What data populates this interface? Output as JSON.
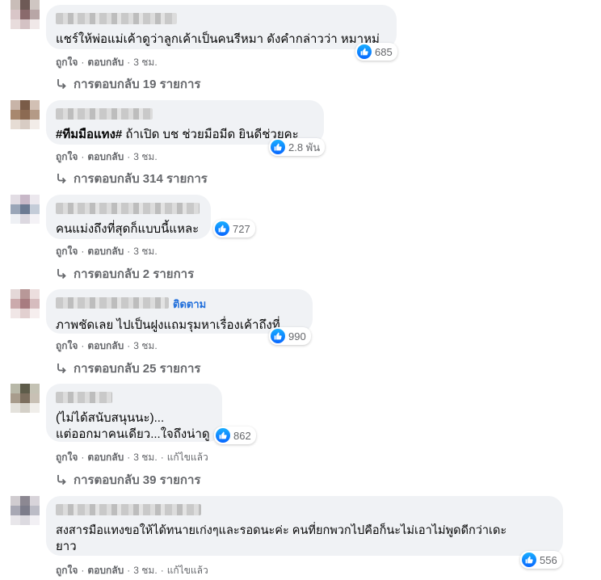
{
  "labels": {
    "like": "ถูกใจ",
    "reply": "ตอบกลับ",
    "edited": "แก้ไขแล้ว",
    "follow": "ติดตาม",
    "dot": "·"
  },
  "colors": {
    "bubble": "#f0f2f5",
    "secondary_text": "#65676b",
    "link_blue": "#216fdb",
    "like_blue": "#0866ff"
  },
  "comments": [
    {
      "text": "แชร์ให้พ่อแม่เค้าดูว่าลูกเค้าเป็นคนรีหมา ดังคำกล่าวว่า หมาหมู่",
      "reaction_count": "685",
      "time": "3 ชม.",
      "replies": "การตอบกลับ 19 รายการ"
    },
    {
      "hashtag": "#ทีมมือแทง#",
      "text": " ถ้าเปิด บช ช่วยมือมีด ยินดีช่วยคะ",
      "reaction_count": "2.8 พัน",
      "time": "3 ชม.",
      "replies": "การตอบกลับ 314 รายการ"
    },
    {
      "text": "คนแม่งถึงที่สุดก็แบบนี้แหละ",
      "reaction_count": "727",
      "time": "3 ชม.",
      "replies": "การตอบกลับ 2 รายการ"
    },
    {
      "text": "ภาพชัดเลย ไปเป็นฝูงแถมรุมหาเรื่องเค้าถึงที่ ...",
      "reaction_count": "990",
      "time": "3 ชม.",
      "replies": "การตอบกลับ 25 รายการ"
    },
    {
      "text_line1": "(ไม่ได้สนับสนุนนะ)...",
      "text_line2": "แต่ออกมาคนเดียว...ใจถึงน่าดู",
      "reaction_count": "862",
      "time": "3 ชม.",
      "replies": "การตอบกลับ 39 รายการ"
    },
    {
      "text_line1": "สงสารมือแทงขอให้ได้ทนายเก่งๆและรอดนะค่ะ คนที่ยกพวกไปคือก็นะไม่เอาไม่พูดดีกว่าเดะ",
      "text_line2": "ยาว",
      "reaction_count": "556",
      "time": "3 ชม."
    }
  ]
}
